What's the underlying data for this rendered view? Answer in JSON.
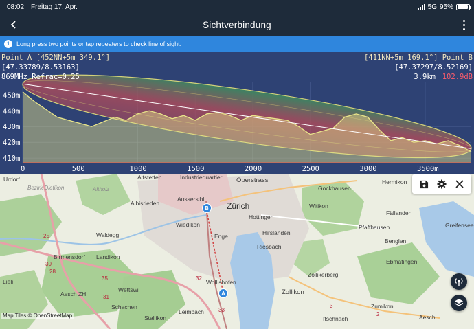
{
  "status": {
    "time": "08:02",
    "date": "Freitag 17. Apr.",
    "network": "5G",
    "battery": "95%"
  },
  "appbar": {
    "title": "Sichtverbindung"
  },
  "info": {
    "text": "Long press two points or tap repeaters to check line of sight."
  },
  "chart_header": {
    "point_a": "Point A [452NN+5m 349.1°]",
    "coord_a": "[47.33789/8.53163]",
    "params": "869MHz Refrac=0.25",
    "point_b": "[411NN+5m 169.1°] Point B",
    "coord_b": "[47.37297/8.52169]",
    "distance": "3.9km",
    "loss": "102.9dB"
  },
  "chart_data": {
    "type": "area",
    "y_ticks": [
      "450m",
      "440m",
      "430m",
      "420m",
      "410m"
    ],
    "y_values": [
      450,
      440,
      430,
      420,
      410
    ],
    "x_ticks": [
      "0",
      "500",
      "1000",
      "1500",
      "2000",
      "2500",
      "3000",
      "3500m"
    ],
    "x_values": [
      0,
      500,
      1000,
      1500,
      2000,
      2500,
      3000,
      3500
    ],
    "xlim": [
      0,
      3900
    ],
    "ylim": [
      407,
      458
    ],
    "line_of_sight": {
      "start": [
        0,
        457
      ],
      "end": [
        3900,
        416
      ]
    },
    "terrain": {
      "x": [
        0,
        100,
        200,
        300,
        400,
        500,
        600,
        700,
        800,
        900,
        1000,
        1100,
        1200,
        1300,
        1400,
        1500,
        1600,
        1700,
        1800,
        1900,
        2000,
        2100,
        2200,
        2300,
        2400,
        2500,
        2600,
        2700,
        2800,
        2900,
        3000,
        3100,
        3200,
        3300,
        3400,
        3500,
        3600,
        3700,
        3800,
        3900
      ],
      "y": [
        452,
        446,
        441,
        436,
        434,
        432,
        430,
        433,
        436,
        434,
        438,
        440,
        438,
        435,
        437,
        434,
        438,
        439,
        437,
        434,
        437,
        436,
        435,
        434,
        430,
        425,
        427,
        429,
        436,
        438,
        436,
        428,
        421,
        423,
        420,
        421,
        419,
        421,
        418,
        414
      ]
    },
    "colors": {
      "terrain": "#e9e58a",
      "los": "#ffffff",
      "fresnel": "#d3d27a",
      "background": "#2e4274"
    }
  },
  "map": {
    "labels": [
      "Urdorf",
      "Altstetten",
      "Industriequartier",
      "Oberstrass",
      "Hermikon",
      "Gockhausen",
      "Bezirk Dietikon",
      "Altholz",
      "Albisrieden",
      "Aussersihl",
      "Zürich",
      "Witikon",
      "Hottingen",
      "Fällanden",
      "Wiedikon",
      "Hirslanden",
      "Pfaffhausen",
      "Waldegg",
      "Enge",
      "Riesbach",
      "Benglen",
      "Greifensee",
      "Birmensdorf",
      "Landikon",
      "Ebmatingen",
      "Lieli",
      "Wettswil",
      "Zollikerberg",
      "Wollishofen",
      "Aesch ZH",
      "Zollikon",
      "Zumikon",
      "Schachen",
      "Stallikon",
      "Leimbach",
      "Itschnach",
      "Aesch"
    ],
    "road_numbers": [
      "25",
      "30",
      "28",
      "35",
      "31",
      "32",
      "33",
      "2",
      "3"
    ],
    "attribution": "Map Tiles © OpenStreetMap",
    "pin_a": "A",
    "pin_b": "B"
  },
  "toolbar": {
    "save_icon": "save-icon",
    "settings_icon": "gear-icon",
    "close_icon": "close-icon"
  }
}
